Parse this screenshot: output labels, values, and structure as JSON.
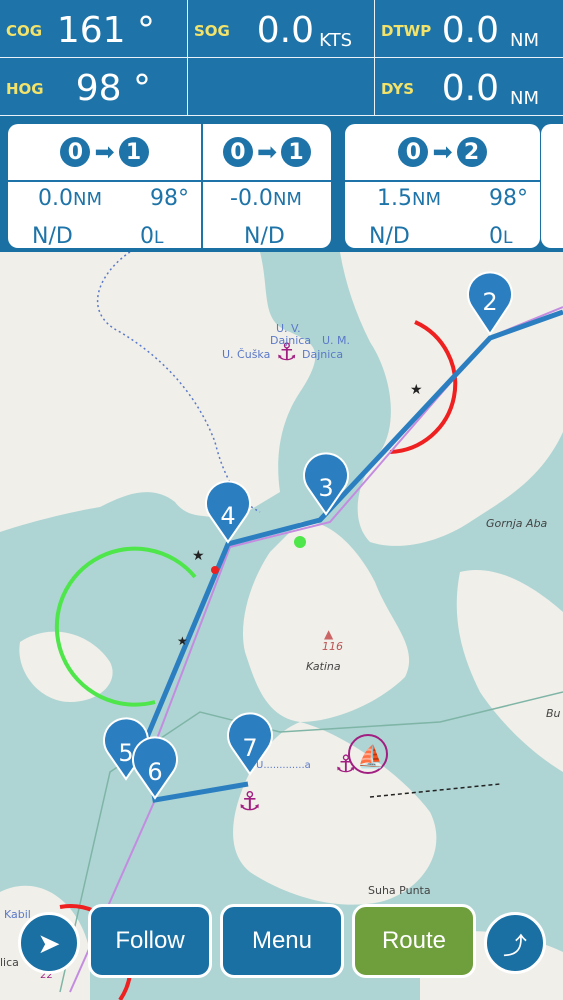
{
  "instruments": {
    "cog": {
      "label": "COG",
      "value": "161 °",
      "unit": ""
    },
    "sog": {
      "label": "SOG",
      "value": "0.0",
      "unit": "KTS"
    },
    "dtwp": {
      "label": "DTWP",
      "value": "0.0",
      "unit": "NM"
    },
    "hog": {
      "label": "HOG",
      "value": "98 °",
      "unit": ""
    },
    "dys": {
      "label": "DYS",
      "value": "0.0",
      "unit": "NM"
    }
  },
  "legs": [
    {
      "from": "0",
      "to": "1",
      "dist": "0.0",
      "unit": "NM",
      "bearing": "98°",
      "eta": "N/D",
      "fuel": "0",
      "fuel_unit": "L"
    },
    {
      "from": "0",
      "to": "1",
      "dist": "-0.0",
      "unit": "NM",
      "bearing": "",
      "eta": "N/D",
      "fuel": "",
      "fuel_unit": ""
    },
    {
      "from": "0",
      "to": "2",
      "dist": "1.5",
      "unit": "NM",
      "bearing": "98°",
      "eta": "N/D",
      "fuel": "0",
      "fuel_unit": "L"
    }
  ],
  "map": {
    "labels": {
      "uv_dajnica": "U. V.",
      "dajnica1": "Dajnica",
      "u_m": "U. M.",
      "u_cuska": "U. Čuška",
      "dajnica2": "Dajnica",
      "gornja_aba": "Gornja Aba",
      "height": "116",
      "katina": "Katina",
      "bu": "Bu",
      "suha_punta": "Suha Punta",
      "kabil": "Kabil",
      "lica": "lica",
      "n22": "22",
      "pos_lbl": "U.............a"
    },
    "waypoints": [
      "2",
      "3",
      "4",
      "5",
      "6",
      "7"
    ]
  },
  "buttons": {
    "follow": "Follow",
    "menu": "Menu",
    "route": "Route"
  },
  "colors": {
    "primary": "#1e74a8",
    "route_btn": "#6f9e3c",
    "label_yellow": "#f3e36a"
  }
}
